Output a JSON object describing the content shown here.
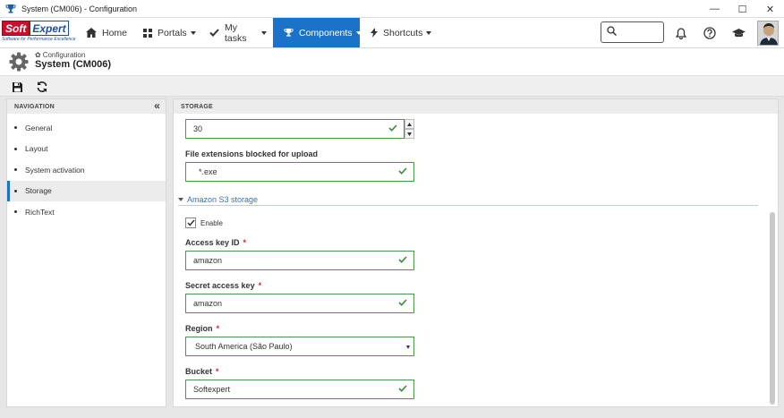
{
  "window": {
    "title": "System (CM006) - Configuration",
    "controls": {
      "minimize": "—",
      "maximize": "☐",
      "close": "✕"
    }
  },
  "logo": {
    "part1": "Soft",
    "part2": "Expert",
    "tagline": "Software for Performance Excellence"
  },
  "nav": {
    "items": [
      {
        "label": "Home",
        "icon": "home-icon"
      },
      {
        "label": "Portals",
        "icon": "grid-icon"
      },
      {
        "label": "My tasks",
        "icon": "check-icon"
      },
      {
        "label": "Components",
        "icon": "trophy-icon"
      },
      {
        "label": "Shortcuts",
        "icon": "lightning-icon"
      }
    ],
    "active": "Components",
    "search_placeholder": ""
  },
  "header": {
    "breadcrumb": "Configuration",
    "title": "System (CM006)"
  },
  "left_panel": {
    "title": "NAVIGATION",
    "items": [
      {
        "label": "General"
      },
      {
        "label": "Layout"
      },
      {
        "label": "System activation"
      },
      {
        "label": "Storage"
      },
      {
        "label": "RichText"
      }
    ],
    "active": "Storage"
  },
  "main_panel": {
    "title": "STORAGE",
    "number_field_value": "30",
    "blocked_ext_label": "File extensions blocked for upload",
    "blocked_ext_value": "*.exe",
    "s3_section_label": "Amazon S3 storage",
    "enable_label": "Enable",
    "access_key_label": "Access key ID",
    "access_key_value": "amazon",
    "secret_key_label": "Secret access key",
    "secret_key_value": "amazon",
    "region_label": "Region",
    "region_value": "South America (São Paulo)",
    "bucket_label": "Bucket",
    "bucket_value": "Softexpert",
    "required_mark": "*"
  },
  "colors": {
    "accent": "#1a73c9",
    "valid_border": "#4a9a4a",
    "required": "#d9261c"
  }
}
